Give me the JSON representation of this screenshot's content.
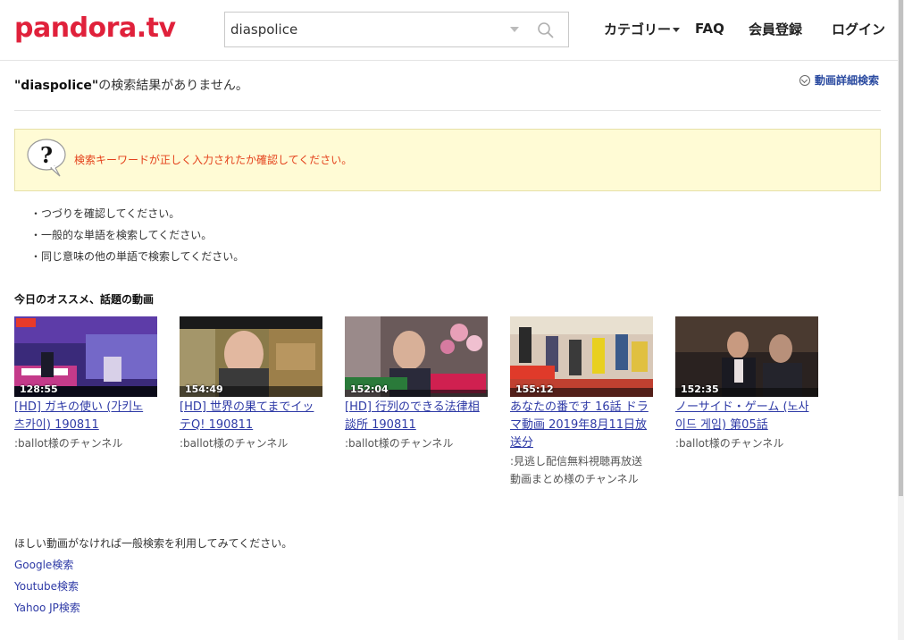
{
  "header": {
    "logo": "pandora.tv",
    "search_value": "diaspolice",
    "nav": {
      "category": "カテゴリー",
      "faq": "FAQ",
      "register": "会員登録",
      "login": "ログイン"
    }
  },
  "result": {
    "keyword": "\"diaspolice\"",
    "message": "の検索結果がありません。",
    "advanced_search": "動画詳細検索"
  },
  "warning": {
    "text": "検索キーワードが正しく入力されたか確認してください。"
  },
  "tips": [
    "・つづりを確認してください。",
    "・一般的な単語を検索してください。",
    "・同じ意味の他の単語で検索してください。"
  ],
  "recommend": {
    "title": "今日のオススメ、話題の動画",
    "videos": [
      {
        "duration": "128:55",
        "title": "[HD] ガキの使い (가키노 츠카이) 190811",
        "channel": ":ballot様のチャンネル"
      },
      {
        "duration": "154:49",
        "title": "[HD] 世界の果てまでイッテQ! 190811",
        "channel": ":ballot様のチャンネル"
      },
      {
        "duration": "152:04",
        "title": "[HD] 行列のできる法律相談所 190811",
        "channel": ":ballot様のチャンネル"
      },
      {
        "duration": "155:12",
        "title": "あなたの番です 16話 ドラマ動画 2019年8月11日放送分",
        "channel": ":見逃し配信無料視聴再放送動画まとめ様のチャンネル"
      },
      {
        "duration": "152:35",
        "title": "ノーサイド・ゲーム (노사이드 게임) 第05話",
        "channel": ":ballot様のチャンネル"
      }
    ]
  },
  "bottom": {
    "note": "ほしい動画がなければ一般検索を利用してみてください。",
    "links": [
      "Google検索",
      "Youtube検索",
      "Yahoo JP検索"
    ]
  },
  "colors": {
    "brand": "#e0213b",
    "link": "#2e3aa6",
    "warning_bg": "#fffbd5",
    "warning_text": "#e4411b"
  }
}
